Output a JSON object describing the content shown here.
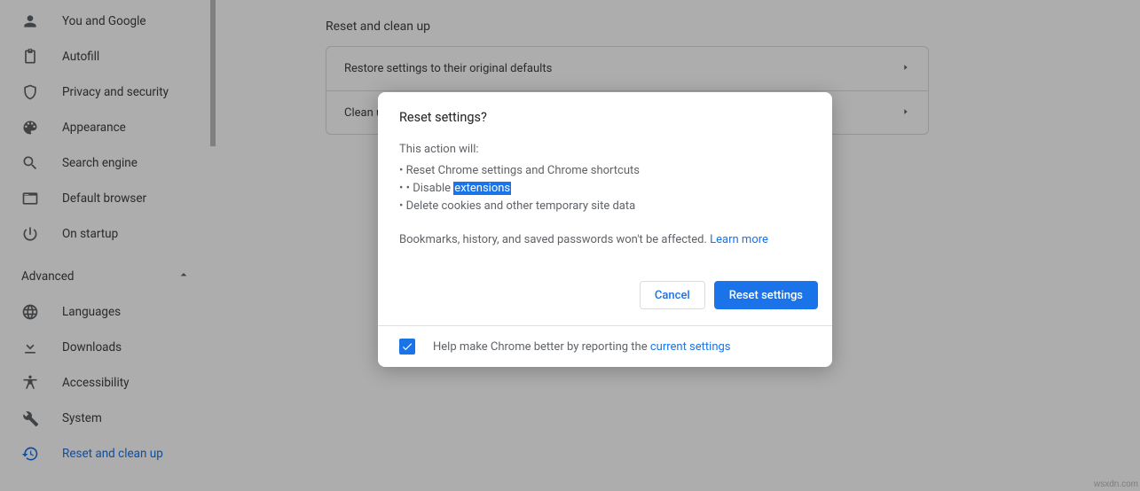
{
  "sidebar": {
    "items": [
      {
        "label": "You and Google"
      },
      {
        "label": "Autofill"
      },
      {
        "label": "Privacy and security"
      },
      {
        "label": "Appearance"
      },
      {
        "label": "Search engine"
      },
      {
        "label": "Default browser"
      },
      {
        "label": "On startup"
      }
    ],
    "advanced_label": "Advanced",
    "advanced_items": [
      {
        "label": "Languages"
      },
      {
        "label": "Downloads"
      },
      {
        "label": "Accessibility"
      },
      {
        "label": "System"
      },
      {
        "label": "Reset and clean up"
      }
    ]
  },
  "main": {
    "section_title": "Reset and clean up",
    "rows": [
      {
        "label": "Restore settings to their original defaults"
      },
      {
        "label": "Clean u"
      }
    ]
  },
  "dialog": {
    "title": "Reset settings?",
    "intro": "This action will:",
    "bullet_1": "Reset Chrome settings and Chrome shortcuts",
    "bullet_2_pre": "Disable ",
    "bullet_2_hl": "extensions",
    "bullet_3": "Delete cookies and other temporary site data",
    "note_pre": "Bookmarks, history, and saved passwords won't be affected. ",
    "learn_more": "Learn more",
    "cancel": "Cancel",
    "confirm": "Reset settings",
    "footer_pre": "Help make Chrome better by reporting the ",
    "footer_link": "current settings"
  },
  "watermark": "wsxdn.com"
}
